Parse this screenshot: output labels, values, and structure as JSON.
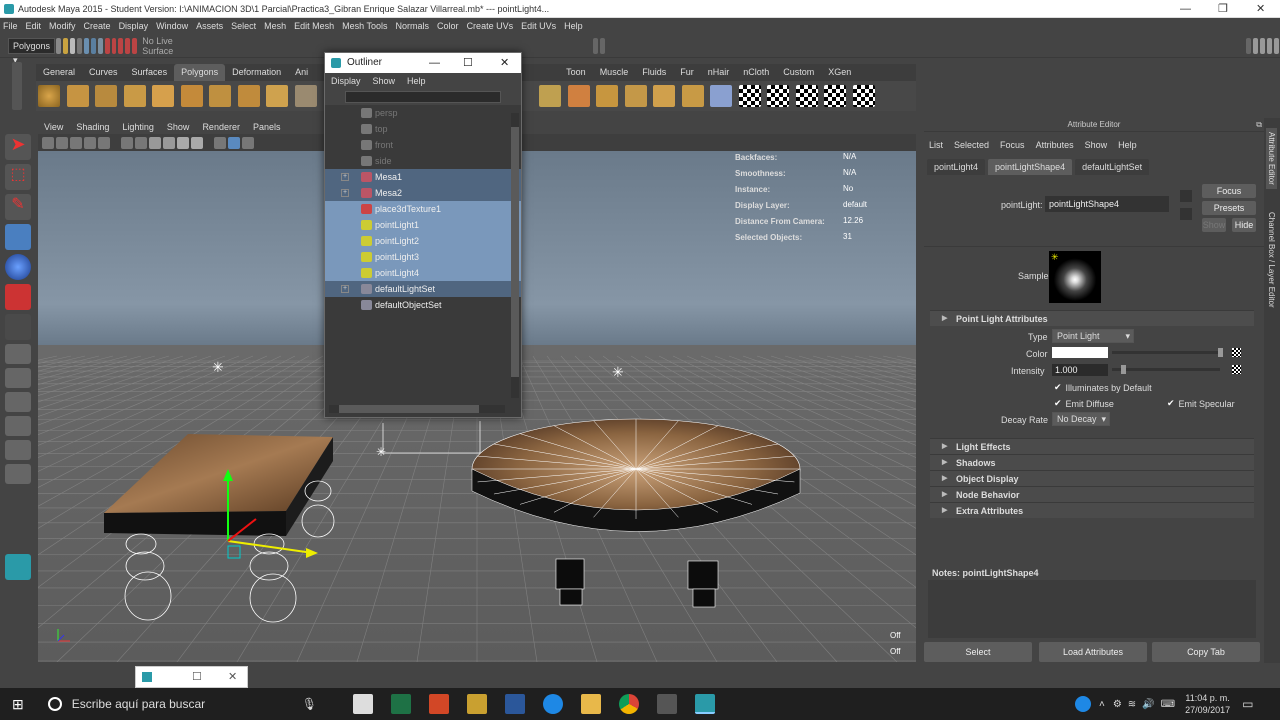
{
  "window": {
    "title": "Autodesk Maya 2015 - Student Version: I:\\ANIMACION 3D\\1 Parcial\\Practica3_Gibran Enrique Salazar Villarreal.mb*  ---  pointLight4..."
  },
  "menubar": [
    "File",
    "Edit",
    "Modify",
    "Create",
    "Display",
    "Window",
    "Assets",
    "Select",
    "Mesh",
    "Edit Mesh",
    "Mesh Tools",
    "Normals",
    "Color",
    "Create UVs",
    "Edit UVs",
    "Help"
  ],
  "statusline": {
    "mode": "Polygons",
    "live_surface": "No Live Surface"
  },
  "shelf": {
    "tabs": [
      "General",
      "Curves",
      "Surfaces",
      "Polygons",
      "Deformation",
      "Ani",
      "Toon",
      "Muscle",
      "Fluids",
      "Fur",
      "nHair",
      "nCloth",
      "Custom",
      "XGen"
    ],
    "active": "Polygons"
  },
  "viewport": {
    "menu": [
      "View",
      "Shading",
      "Lighting",
      "Show",
      "Renderer",
      "Panels"
    ],
    "hud": [
      {
        "label": "Backfaces:",
        "value": "N/A"
      },
      {
        "label": "Smoothness:",
        "value": "N/A"
      },
      {
        "label": "Instance:",
        "value": "No"
      },
      {
        "label": "Display Layer:",
        "value": "default"
      },
      {
        "label": "Distance From Camera:",
        "value": "12.26"
      },
      {
        "label": "Selected Objects:",
        "value": "31"
      }
    ],
    "off1": "Off",
    "off2": "Off"
  },
  "outliner": {
    "title": "Outliner",
    "menu": [
      "Display",
      "Show",
      "Help"
    ],
    "items": [
      {
        "label": "persp",
        "state": "dim",
        "expand": false,
        "icon": "camera-icon"
      },
      {
        "label": "top",
        "state": "dim",
        "expand": false,
        "icon": "camera-icon"
      },
      {
        "label": "front",
        "state": "dim",
        "expand": false,
        "icon": "camera-icon"
      },
      {
        "label": "side",
        "state": "dim",
        "expand": false,
        "icon": "camera-icon"
      },
      {
        "label": "Mesa1",
        "state": "sel1",
        "expand": true,
        "icon": "mesh-icon"
      },
      {
        "label": "Mesa2",
        "state": "sel1",
        "expand": true,
        "icon": "mesh-icon"
      },
      {
        "label": "place3dTexture1",
        "state": "sel2",
        "expand": false,
        "icon": "texture-icon"
      },
      {
        "label": "pointLight1",
        "state": "sel2",
        "expand": false,
        "icon": "light-icon"
      },
      {
        "label": "pointLight2",
        "state": "sel2",
        "expand": false,
        "icon": "light-icon"
      },
      {
        "label": "pointLight3",
        "state": "sel2",
        "expand": false,
        "icon": "light-icon"
      },
      {
        "label": "pointLight4",
        "state": "sel2",
        "expand": false,
        "icon": "light-icon"
      },
      {
        "label": "defaultLightSet",
        "state": "sel1",
        "expand": true,
        "icon": "set-icon"
      },
      {
        "label": "defaultObjectSet",
        "state": "normal",
        "expand": false,
        "icon": "set-icon"
      }
    ]
  },
  "attribute_editor": {
    "title": "Attribute Editor",
    "menu": [
      "List",
      "Selected",
      "Focus",
      "Attributes",
      "Show",
      "Help"
    ],
    "tabs": [
      "pointLight4",
      "pointLightShape4",
      "defaultLightSet"
    ],
    "active_tab": "pointLightShape4",
    "node_label": "pointLight:",
    "node_value": "pointLightShape4",
    "focus": "Focus",
    "presets": "Presets",
    "show": "Show",
    "hide": "Hide",
    "sample": "Sample",
    "section_title": "Point Light Attributes",
    "type_label": "Type",
    "type_value": "Point Light",
    "color_label": "Color",
    "intensity_label": "Intensity",
    "intensity_value": "1.000",
    "illuminates": "Illuminates by Default",
    "emit_diffuse": "Emit Diffuse",
    "emit_specular": "Emit Specular",
    "decay_label": "Decay Rate",
    "decay_value": "No Decay",
    "collapsed_sections": [
      "Light Effects",
      "Shadows",
      "Object Display",
      "Node Behavior",
      "Extra Attributes"
    ],
    "notes": "Notes:  pointLightShape4",
    "buttons": [
      "Select",
      "Load Attributes",
      "Copy Tab"
    ],
    "side_tabs": [
      "Attribute Editor",
      "Channel Box / Layer Editor"
    ]
  },
  "taskbar": {
    "search": "Escribe aquí para buscar",
    "time": "11:04 p. m.",
    "date": "27/09/2017"
  }
}
